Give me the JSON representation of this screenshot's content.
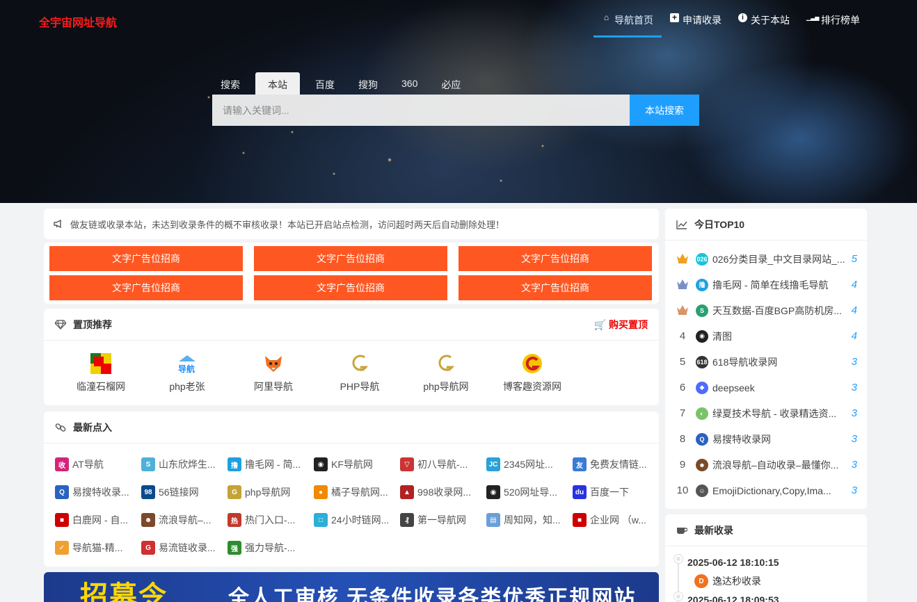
{
  "brand": "全宇宙网址导航",
  "nav": [
    {
      "label": "导航首页",
      "icon": "home-icon",
      "glyph": "⌂"
    },
    {
      "label": "申请收录",
      "icon": "plus-square-icon",
      "glyph": "+"
    },
    {
      "label": "关于本站",
      "icon": "info-circle-icon",
      "glyph": "i"
    },
    {
      "label": "排行榜单",
      "icon": "signal-bars-icon",
      "glyph": "▁▃▅"
    }
  ],
  "search": {
    "tabs": [
      "搜索",
      "本站",
      "百度",
      "搜狗",
      "360",
      "必应"
    ],
    "active_tab": "本站",
    "placeholder": "请输入关键词...",
    "button": "本站搜索"
  },
  "notice": {
    "icon": "bullhorn-icon",
    "text": "做友链或收录本站，未达到收录条件的概不审核收录！本站已开启站点检测，访问超时两天后自动删除处理！"
  },
  "ads": [
    "文字广告位招商",
    "文字广告位招商",
    "文字广告位招商",
    "文字广告位招商",
    "文字广告位招商",
    "文字广告位招商"
  ],
  "pinned": {
    "title": "置顶推荐",
    "icon": "diamond-icon",
    "buy_label": "购买置顶",
    "buy_icon": "cart-icon",
    "items": [
      {
        "name": "临潼石榴网"
      },
      {
        "name": "php老张"
      },
      {
        "name": "阿里导航"
      },
      {
        "name": "PHP导航"
      },
      {
        "name": "php导航网"
      },
      {
        "name": "博客趣资源网"
      }
    ]
  },
  "latest_in": {
    "title": "最新点入",
    "icon": "link-icon",
    "items": [
      {
        "name": "AT导航",
        "color": "#d4237a",
        "glyph": "收"
      },
      {
        "name": "山东欣烨生...",
        "color": "#4fb0d8",
        "glyph": "S"
      },
      {
        "name": "撸毛网 - 简...",
        "color": "#1ea0e0",
        "glyph": "撸"
      },
      {
        "name": "KF导航网",
        "color": "#222222",
        "glyph": "◉"
      },
      {
        "name": "初八导航-...",
        "color": "#cc3333",
        "glyph": "▽"
      },
      {
        "name": "2345网址...",
        "color": "#2aa1d8",
        "glyph": "JC"
      },
      {
        "name": "免费友情链...",
        "color": "#3a7bd5",
        "glyph": "友"
      },
      {
        "name": "易搜特收录...",
        "color": "#2b62c0",
        "glyph": "Q"
      },
      {
        "name": "56链接网",
        "color": "#0b4a8c",
        "glyph": "98"
      },
      {
        "name": "php导航网",
        "color": "#c4a236",
        "glyph": "G"
      },
      {
        "name": "橘子导航网...",
        "color": "#f08a00",
        "glyph": "●"
      },
      {
        "name": "998收录网...",
        "color": "#b22222",
        "glyph": "▲"
      },
      {
        "name": "520网址导...",
        "color": "#222222",
        "glyph": "◉"
      },
      {
        "name": "百度一下",
        "color": "#2932e1",
        "glyph": "du"
      },
      {
        "name": "白鹿网 - 自...",
        "color": "#cc0000",
        "glyph": "■"
      },
      {
        "name": "流浪导航–...",
        "color": "#7a4a2a",
        "glyph": "☻"
      },
      {
        "name": "热门入口-...",
        "color": "#c0392b",
        "glyph": "热"
      },
      {
        "name": "24小时链网...",
        "color": "#2bb0d6",
        "glyph": "□"
      },
      {
        "name": "第一导航网",
        "color": "#444444",
        "glyph": "₰"
      },
      {
        "name": "周知网，知...",
        "color": "#6aa0d8",
        "glyph": "▤"
      },
      {
        "name": "企业网 （w...",
        "color": "#cc0000",
        "glyph": "■"
      },
      {
        "name": "导航猫-精...",
        "color": "#f0a030",
        "glyph": "✓"
      },
      {
        "name": "易流链收录...",
        "color": "#d03030",
        "glyph": "G"
      },
      {
        "name": "强力导航-...",
        "color": "#2e8b2e",
        "glyph": "强"
      }
    ]
  },
  "banner": {
    "left_text": "招募令",
    "right_text": "全人工审核  无条件收录各类优秀正规网站"
  },
  "top10": {
    "title": "今日TOP10",
    "icon": "line-chart-icon",
    "items": [
      {
        "rank": "1",
        "title": "026分类目录_中文目录网站_...",
        "count": "5",
        "color": "#19c3d8",
        "glyph": "026",
        "crown": "#f0a020"
      },
      {
        "rank": "2",
        "title": "撸毛网 - 简单在线撸毛导航",
        "count": "4",
        "color": "#1ea0e0",
        "glyph": "撸",
        "crown": "#7b8fc4"
      },
      {
        "rank": "3",
        "title": "天互数据-百度BGP高防机房...",
        "count": "4",
        "color": "#2aa070",
        "glyph": "S",
        "crown": "#d8956a"
      },
      {
        "rank": "4",
        "title": "清图",
        "count": "4",
        "color": "#222222",
        "glyph": "◉"
      },
      {
        "rank": "5",
        "title": "618导航收录网",
        "count": "3",
        "color": "#333333",
        "glyph": "618"
      },
      {
        "rank": "6",
        "title": "deepseek",
        "count": "3",
        "color": "#4d6bfe",
        "glyph": "◆"
      },
      {
        "rank": "7",
        "title": "绿夏技术导航 - 收录精选资...",
        "count": "3",
        "color": "#7cc26a",
        "glyph": "◐"
      },
      {
        "rank": "8",
        "title": "易搜特收录网",
        "count": "3",
        "color": "#2b62c0",
        "glyph": "Q"
      },
      {
        "rank": "9",
        "title": "流浪导航–自动收录–最懂你...",
        "count": "3",
        "color": "#7a4a2a",
        "glyph": "☻"
      },
      {
        "rank": "10",
        "title": "EmojiDictionary,Copy,Ima...",
        "count": "3",
        "color": "#555555",
        "glyph": "☺"
      }
    ]
  },
  "recent": {
    "title": "最新收录",
    "icon": "coffee-cup-icon",
    "items": [
      {
        "date": "2025-06-12 18:10:15",
        "site": "逸达秒收录",
        "color": "#f07020",
        "glyph": "D"
      },
      {
        "date": "2025-06-12 18:09:53",
        "site": "",
        "color": "#999999",
        "glyph": ""
      }
    ]
  }
}
